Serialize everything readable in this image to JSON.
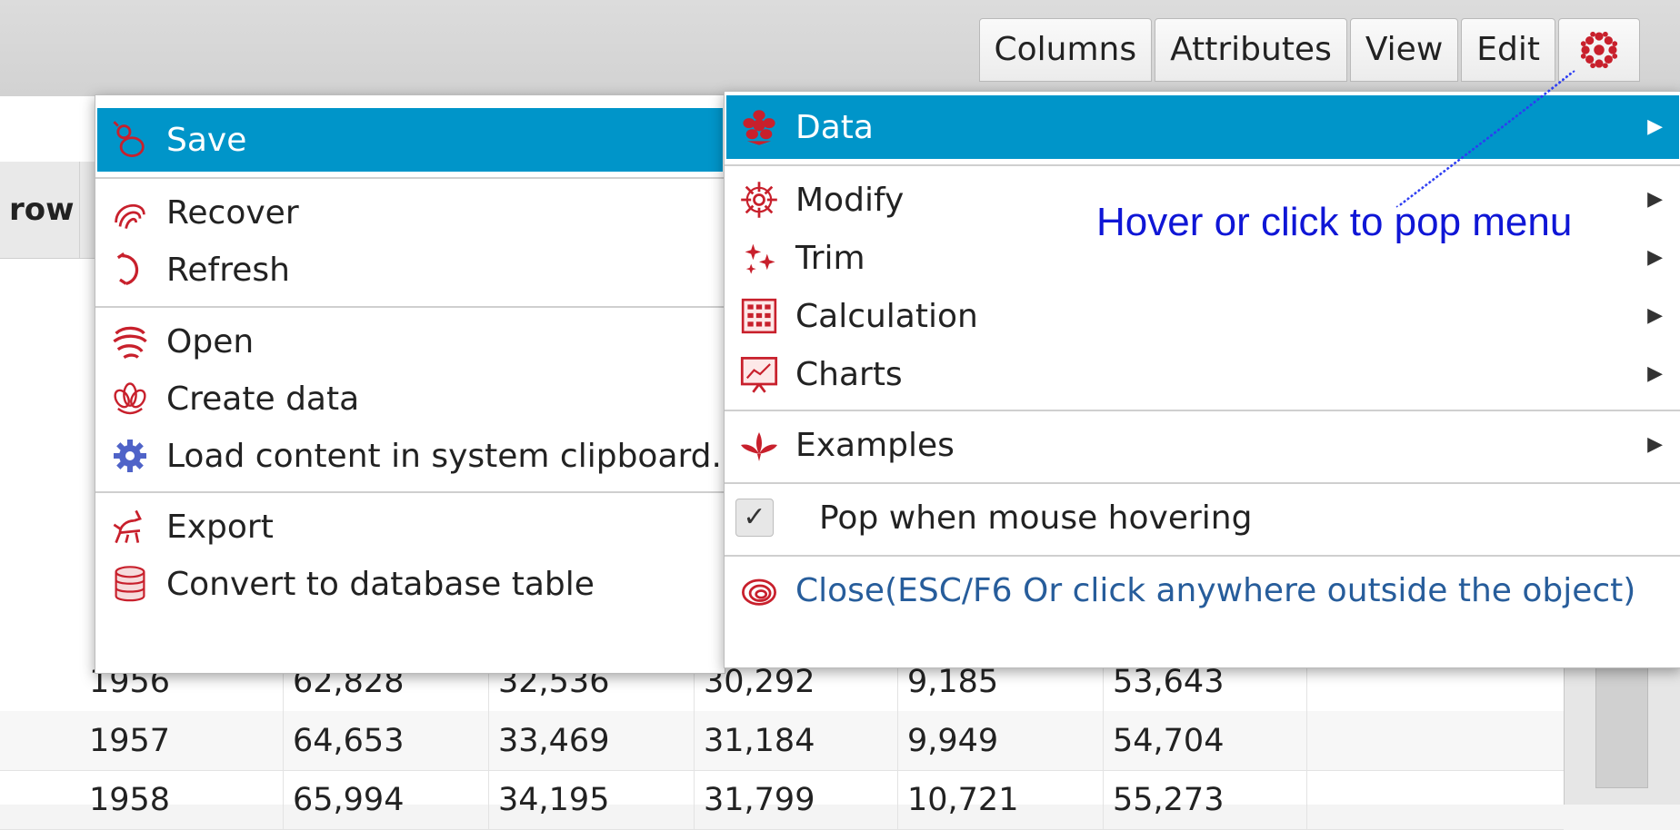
{
  "tabs": [
    "Columns",
    "Attributes",
    "View",
    "Edit"
  ],
  "table": {
    "header_first": "row",
    "rows": [
      [
        "1956",
        "62,828",
        "32,536",
        "30,292",
        "9,185",
        "53,643"
      ],
      [
        "1957",
        "64,653",
        "33,469",
        "31,184",
        "9,949",
        "54,704"
      ],
      [
        "1958",
        "65,994",
        "34,195",
        "31,799",
        "10,721",
        "55,273"
      ]
    ]
  },
  "left_menu": {
    "save": "Save",
    "recover": "Recover",
    "refresh": "Refresh",
    "open": "Open",
    "create_data": "Create data",
    "load_clipboard": "Load content in system clipboard.",
    "export": "Export",
    "convert_db": "Convert to database table"
  },
  "right_menu": {
    "data": "Data",
    "modify": "Modify",
    "trim": "Trim",
    "calculation": "Calculation",
    "charts": "Charts",
    "examples": "Examples",
    "pop_hover": "Pop when mouse hovering",
    "pop_hover_checked": true,
    "close": "Close(ESC/F6 Or click anywhere outside the object)"
  },
  "annotation": "Hover or click to pop menu",
  "colors": {
    "highlight": "#0095c9",
    "icon_red": "#c8202c",
    "annotation": "#0f16d6",
    "close_text": "#275d9b",
    "gear_blue": "#4f63c8"
  },
  "icons": {
    "menu_button": "chrysanthemum-icon",
    "save": "gourd-icon",
    "recover": "swirl-icon",
    "refresh": "dragon-icon",
    "open": "cloud-icon",
    "create_data": "lotus-icon",
    "load_clipboard": "gear-icon",
    "export": "qilin-icon",
    "convert_db": "database-icon",
    "data": "peony-icon",
    "modify": "flower-icon",
    "trim": "sparkle-icon",
    "calculation": "abacus-icon",
    "charts": "chart-board-icon",
    "examples": "bird-icon",
    "close": "spiral-icon"
  }
}
